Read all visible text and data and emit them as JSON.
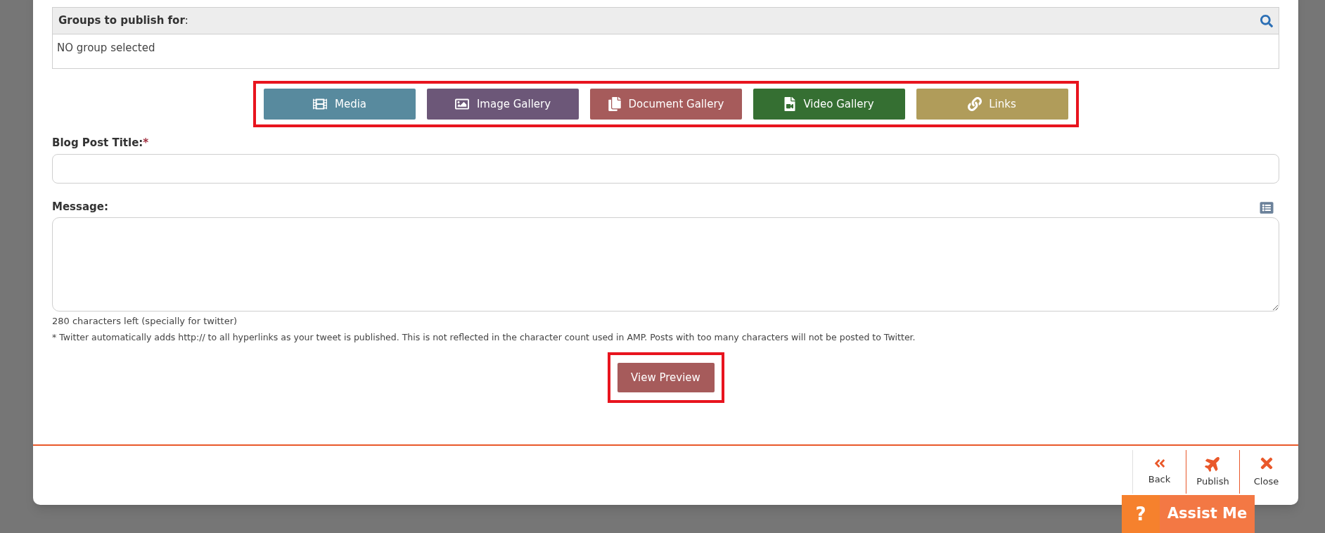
{
  "groups_panel": {
    "title": "Groups to publish for",
    "title_suffix": ":",
    "value": "NO group selected"
  },
  "media_buttons": [
    {
      "kind": "media",
      "label": "Media",
      "color": "#588a9e"
    },
    {
      "kind": "image",
      "label": "Image Gallery",
      "color": "#6c5778"
    },
    {
      "kind": "document",
      "label": "Document Gallery",
      "color": "#a65b5b"
    },
    {
      "kind": "video",
      "label": "Video Gallery",
      "color": "#356f32"
    },
    {
      "kind": "links",
      "label": "Links",
      "color": "#b09c5a"
    }
  ],
  "title_field": {
    "label": "Blog Post Title:",
    "required_mark": "*"
  },
  "message_field": {
    "label": "Message:"
  },
  "chars_left": "280 characters left (specially for twitter)",
  "twitter_note": "* Twitter automatically adds http:// to all hyperlinks as your tweet is published. This is not reflected in the character count used in AMP. Posts with too many characters will not be posted to Twitter.",
  "preview_button": "View Preview",
  "footer_actions": [
    {
      "kind": "back",
      "label": "Back"
    },
    {
      "kind": "publish",
      "label": "Publish"
    },
    {
      "kind": "close",
      "label": "Close"
    }
  ],
  "assist": {
    "icon": "?",
    "label": "Assist Me"
  }
}
